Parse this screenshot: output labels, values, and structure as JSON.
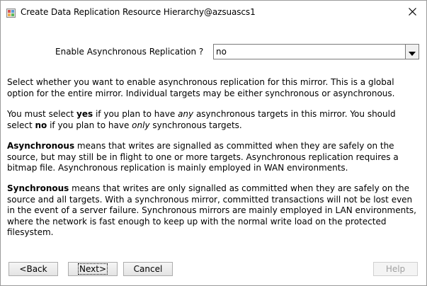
{
  "window": {
    "title": "Create Data Replication Resource Hierarchy@azsuascs1"
  },
  "field": {
    "label": "Enable Asynchronous Replication ?",
    "value": "no"
  },
  "paragraphs": {
    "p1": "Select whether you want to enable asynchronous replication for this mirror. This is a global option for the entire mirror. Individual targets may be either synchronous or asynchronous.",
    "p2": {
      "a": "You must select ",
      "b": "yes",
      "c": " if you plan to have ",
      "d": "any",
      "e": " asynchronous targets in this mirror. You should select ",
      "f": "no",
      "g": " if you plan to have ",
      "h": "only",
      "i": " synchronous targets."
    },
    "p3": {
      "term": "Asynchronous",
      "text": " means that writes are signalled as committed when they are safely on the source, but may still be in flight to one or more targets. Asynchronous replication requires a bitmap file. Asynchronous replication is mainly employed in WAN environments."
    },
    "p4": {
      "term": "Synchronous",
      "text": " means that writes are only signalled as committed when they are safely on the source and all targets. With a synchronous mirror, committed transactions will not be lost even in the event of a server failure. Synchronous mirrors are mainly employed in LAN environments, where the network is fast enough to keep up with the normal write load on the protected filesystem."
    }
  },
  "buttons": {
    "back": "<Back",
    "next": "Next>",
    "cancel": "Cancel",
    "help": "Help"
  },
  "icons": {
    "app": "app-icon",
    "close": "close-icon",
    "dropdown": "chevron-down-icon"
  }
}
